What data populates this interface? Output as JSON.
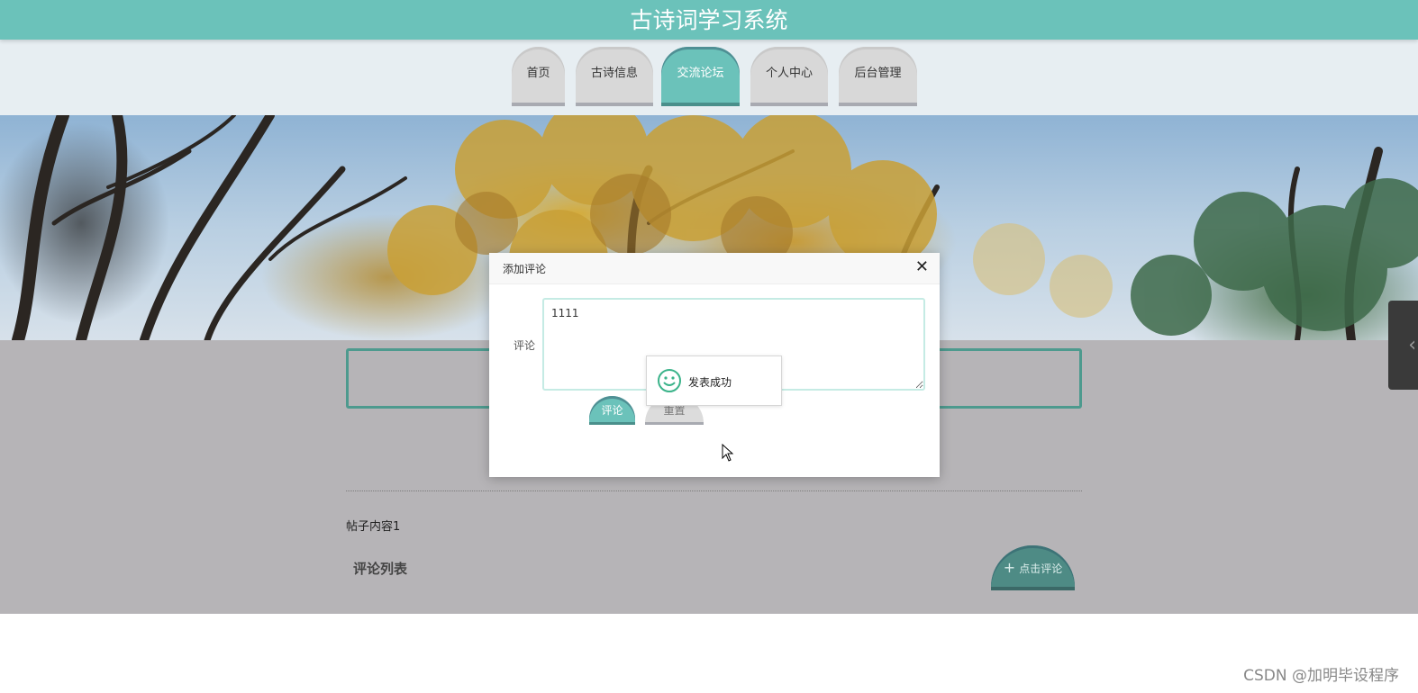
{
  "header": {
    "site_title": "古诗词学习系统",
    "accent_color": "#6bc2ba"
  },
  "nav": {
    "tabs": [
      {
        "label": "首页",
        "active": false
      },
      {
        "label": "古诗信息",
        "active": false
      },
      {
        "label": "交流论坛",
        "active": true
      },
      {
        "label": "个人中心",
        "active": false
      },
      {
        "label": "后台管理",
        "active": false
      }
    ]
  },
  "post": {
    "content": "帖子内容1",
    "comments_heading": "评论列表",
    "add_comment_label": "点击评论",
    "add_comment_icon": "plus-icon"
  },
  "dialog": {
    "title": "添加评论",
    "close_icon": "close-icon",
    "field_label": "评论",
    "comment_value": "1111",
    "submit_label": "评论",
    "reset_label": "重置"
  },
  "toast": {
    "message": "发表成功",
    "icon": "smile-icon",
    "icon_color": "#3bb38a"
  },
  "side_handle": {
    "icon": "chevron-left-icon"
  },
  "watermark": "CSDN @加明毕设程序"
}
